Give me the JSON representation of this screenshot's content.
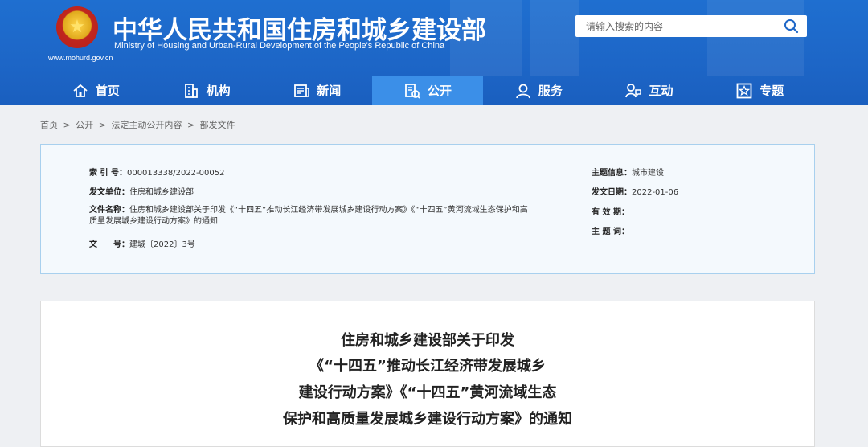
{
  "header": {
    "title_cn": "中华人民共和国住房和城乡建设部",
    "title_en": "Ministry of Housing and Urban-Rural Development of the People's Republic of China",
    "site_url": "www.mohurd.gov.cn",
    "emblem_icon": "national-emblem-icon"
  },
  "search": {
    "placeholder": "请输入搜索的内容",
    "icon": "search-icon"
  },
  "nav": {
    "items": [
      {
        "label": "首页",
        "icon": "home-icon"
      },
      {
        "label": "机构",
        "icon": "building-icon"
      },
      {
        "label": "新闻",
        "icon": "news-icon"
      },
      {
        "label": "公开",
        "icon": "document-icon"
      },
      {
        "label": "服务",
        "icon": "service-icon"
      },
      {
        "label": "互动",
        "icon": "interact-icon"
      },
      {
        "label": "专题",
        "icon": "topic-icon"
      }
    ],
    "active_index": 3
  },
  "breadcrumb": [
    "首页",
    ">",
    "公开",
    ">",
    "法定主动公开内容",
    ">",
    "部发文件"
  ],
  "meta": {
    "index_label": "索 引 号：",
    "index_value": "000013338/2022-00052",
    "issuer_label": "发文单位：",
    "issuer_value": "住房和城乡建设部",
    "name_label": "文件名称：",
    "name_value_1": "住房和城乡建设部关于印发《“十四五”推动长江经济带发展城乡建设行动方案》《“十四五”黄河流域生态保护和高",
    "name_value_2": "质量发展城乡建设行动方案》的通知",
    "docno_label": "文　　号：",
    "docno_value": "建城〔2022〕3号",
    "topic_info_label": "主题信息：",
    "topic_info_value": "城市建设",
    "date_label": "发文日期：",
    "date_value": "2022-01-06",
    "valid_label": "有 效 期：",
    "valid_value": "",
    "subject_label": "主 题 词：",
    "subject_value": ""
  },
  "document": {
    "title_lines": [
      "住房和城乡建设部关于印发",
      "《“十四五”推动长江经济带发展城乡",
      "建设行动方案》《“十四五”黄河流域生态",
      "保护和高质量发展城乡建设行动方案》的通知"
    ]
  },
  "colors": {
    "header_blue": "#1d66c7",
    "nav_active": "#3b8fe8",
    "meta_bg": "#f4f9fd",
    "meta_border": "#a8d0ee"
  }
}
